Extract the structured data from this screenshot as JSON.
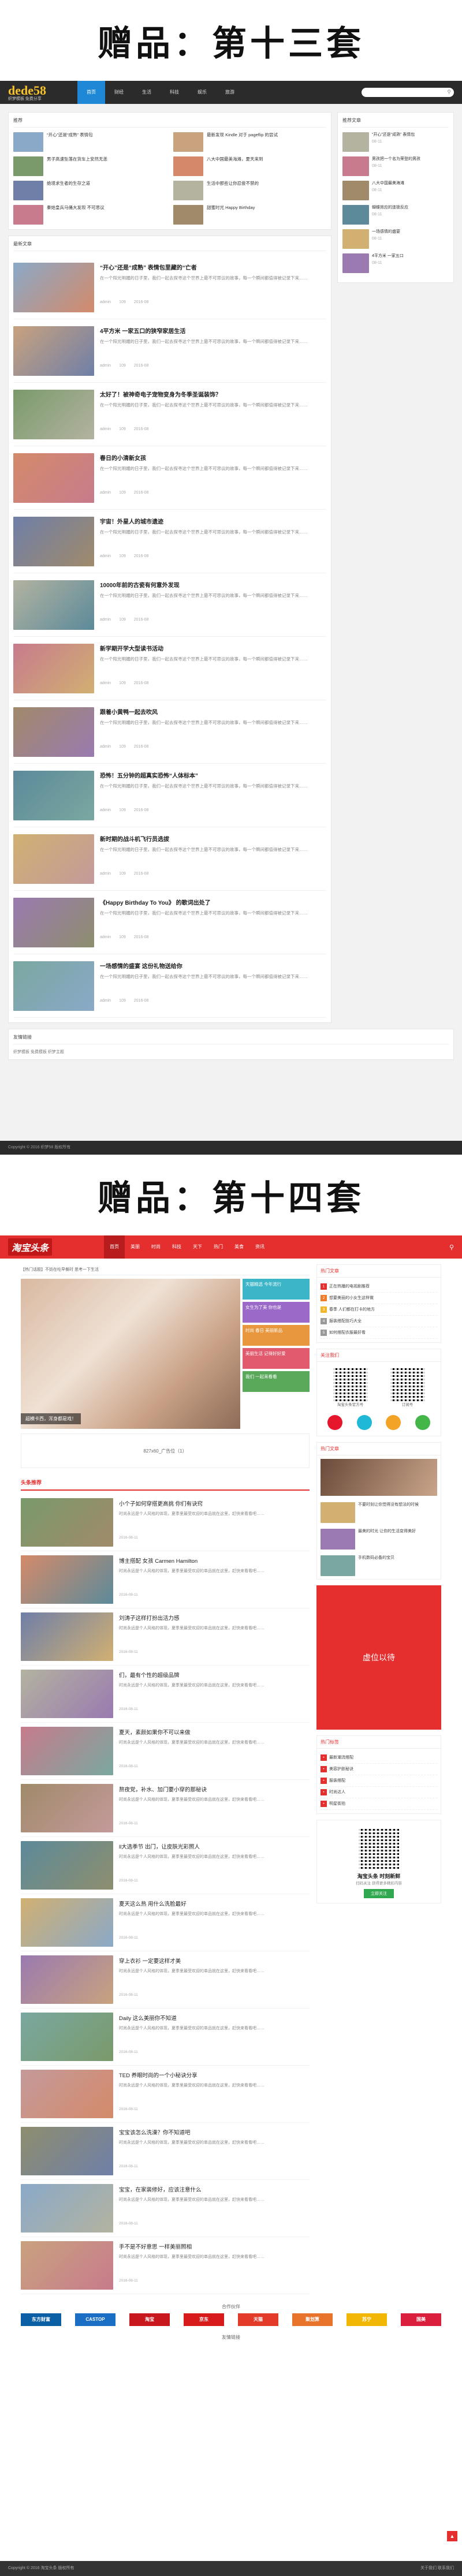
{
  "banner13": "赠品：第十三套",
  "banner14": "赠品：第十四套",
  "t13": {
    "logo": "dede58",
    "logo_sub": "织梦模板 免费分享",
    "nav": [
      "首页",
      "财经",
      "生活",
      "科技",
      "娱乐",
      "旅游"
    ],
    "hot_title": "推荐",
    "hot": [
      {
        "title": "“开心”还是“成熟” 表情包"
      },
      {
        "title": "最新发现 Kindle 对于 pageflip 的尝试"
      },
      {
        "title": "男子高速坠落在货车上安然无恙"
      },
      {
        "title": "八大中国最美海滩，夏天来到"
      },
      {
        "title": "绝境求生者的生存之道"
      },
      {
        "title": "生活中那些让你忍俊不禁的"
      },
      {
        "title": "秦始皇兵马俑大发现 不可思议"
      },
      {
        "title": "甜蜜时光 Happy Birthday"
      }
    ],
    "latest_title": "最新文章",
    "articles": [
      {
        "title": "“开心”还是“成熟” 表情包里藏的“亡者"
      },
      {
        "title": "4平方米 一家五口的狭窄家居生活"
      },
      {
        "title": "太好了！被神奇电子宠物变身为冬季圣诞装饰？"
      },
      {
        "title": "春日的小清新女孩"
      },
      {
        "title": "宇宙！外星人的城市遗迹"
      },
      {
        "title": "10000年前的古瓷有何意外发现"
      },
      {
        "title": "新学期开学大型读书活动"
      },
      {
        "title": "跟着小黄鸭一起去吹风"
      },
      {
        "title": "恐怖！五分钟的超真实恐怖“人体标本”"
      },
      {
        "title": "新时期的战斗机飞行员选拔"
      },
      {
        "title": "《Happy Birthday To You》 的歌词出处了"
      },
      {
        "title": "一场感情的盛宴 这份礼物送给你"
      }
    ],
    "article_excerpt": "在一个阳光明媚的日子里，我们一起去探寻这个世界上最不可思议的故事，每一个瞬间都值得被记录下来……",
    "meta": {
      "author": "admin",
      "views": "109",
      "date": "2016-08"
    },
    "side_title": "推荐文章",
    "side": [
      {
        "title": "“开心”还是“成熟” 表情包",
        "date": "08-11"
      },
      {
        "title": "男孩把一个名为荣登的男孩",
        "date": "08-11"
      },
      {
        "title": "八大中国最美海滩",
        "date": "08-11"
      },
      {
        "title": "蝴蝶效应的连锁反应",
        "date": "08-11"
      },
      {
        "title": "一场感情的盛宴",
        "date": "08-11"
      },
      {
        "title": "4平方米 一家五口",
        "date": "08-11"
      }
    ],
    "friend_title": "友情链接",
    "friend_links": "织梦模板  免费模板  织梦主题",
    "footer": "Copyright © 2016 织梦58 版权所有"
  },
  "t14": {
    "logo": "淘宝头条",
    "nav": [
      "首页",
      "美丽",
      "时尚",
      "科技",
      "天下",
      "热门",
      "美食",
      "资讯"
    ],
    "notice": "【热门话题】不妨在吃早餐时 思考一下生活",
    "hero_caption": "超模卡西，浑身都是戏！",
    "tiles": [
      "天猫精选 今年流行",
      "女生为了美 你也是",
      "时尚 春日 美丽新品",
      "美丽生活 记得好好爱",
      "我们 一起来看看"
    ],
    "ad_text": "827x60_广告位（1）",
    "sect_title": "头条推荐",
    "articles": [
      {
        "title": "小个子如何穿搭更高挑 你们有诀窍"
      },
      {
        "title": "博主搭配 女孩 Carmen Hamilton"
      },
      {
        "title": "刘涛子这样打扮出活力感"
      },
      {
        "title": "们，最有个性的超级品牌"
      },
      {
        "title": "夏天，素颜如果你不可以来做"
      },
      {
        "title": "熬夜党，补水、加门要小穿的那秘诀"
      },
      {
        "title": "ll大选季节 出门，让皮肤光彩照人"
      },
      {
        "title": "夏天这么热 用什么洗脸最好"
      },
      {
        "title": "穿上衣衫 一定要这样才美"
      },
      {
        "title": "Daily 这么美丽你不知道"
      },
      {
        "title": "TED 养眼时尚的一个小秘诀分享"
      },
      {
        "title": "宝宝该怎么洗澡？你不知道吧"
      },
      {
        "title": "宝宝，在家装修好，应该注意什么"
      },
      {
        "title": "手不是不好意思 一样美丽照相"
      }
    ],
    "article_excerpt": "时尚永远是个人风格的体现，夏季里最受欢迎的单品就在这里，赶快来看看吧……",
    "meta": "2016-08-11",
    "hot_title": "热门文章",
    "hot": [
      "正在热播的电视剧推荐",
      "想要美丽的小女生这样做",
      "春季 人们都在打卡的地方",
      "服装搭配技巧大全",
      "如何搭配衣服最好看"
    ],
    "follow_title": "关注我们",
    "qr_caps": [
      "淘宝头条官方号",
      "订阅号"
    ],
    "side_pics": [
      {
        "title": "不要时刻让你觉得没有想法的时候"
      },
      {
        "title": "最美的时光 让你的生活变得美好"
      },
      {
        "title": "手机数码必备的宝贝"
      }
    ],
    "ad_red": "虚位以待",
    "tags_title": "热门标签",
    "tags": [
      "最新潮流搭配",
      "美容护肤秘诀",
      "服装搭配",
      "时尚达人",
      "明星街拍"
    ],
    "promo_title": "淘宝头条 时刻新鲜",
    "promo_sub": "扫码关注 获得更多精彩内容",
    "promo_btn": "立即关注",
    "brand_title": "合作伙伴",
    "brands": [
      "东方财富",
      "CASTOP",
      "淘宝",
      "京东",
      "天猫",
      "聚划算",
      "苏宁",
      "国美"
    ],
    "brand_title2": "友情链接",
    "footer": "Copyright © 2016 淘宝头条 版权所有",
    "footer_right": "关于我们  联系我们"
  },
  "colors": {
    "accent13": "#1e88d6",
    "accent14": "#e52e2e"
  }
}
